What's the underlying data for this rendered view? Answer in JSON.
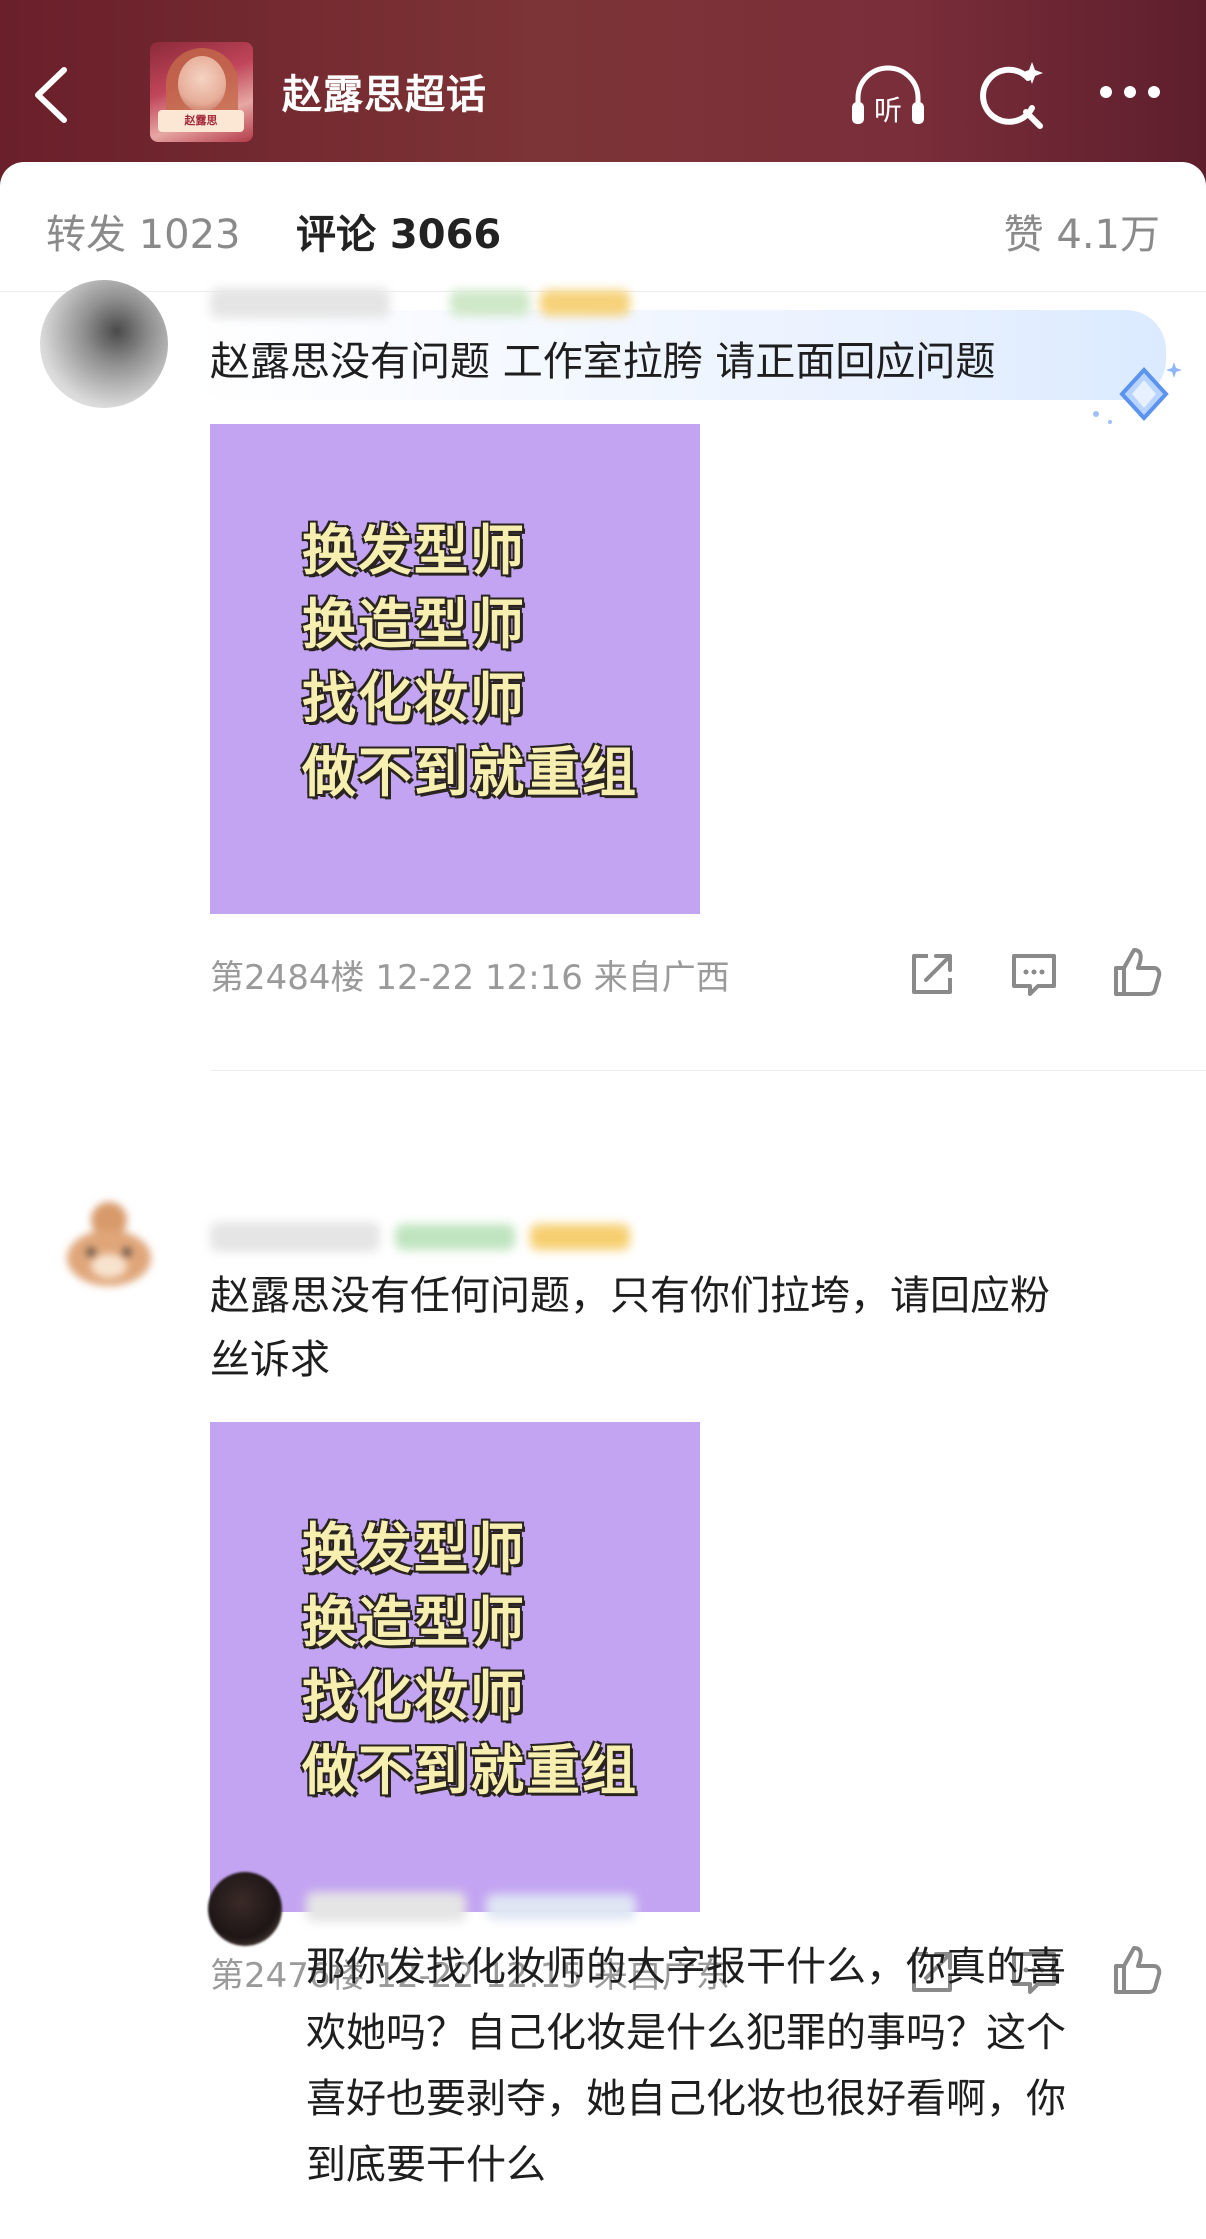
{
  "header": {
    "title": "赵露思超话",
    "avatar_text": "赵露思",
    "icons": [
      "back-arrow-icon",
      "listen-icon",
      "search-icon",
      "more-icon"
    ],
    "listen_label": "听"
  },
  "tabs": {
    "repost": "转发 1023",
    "comments": "评论 3066",
    "likes": "赞 4.1万"
  },
  "comments": [
    {
      "text": "赵露思没有问题 工作室拉胯 请正面回应问题",
      "image_lines": [
        "换发型师",
        "换造型师",
        "找化妆师",
        "做不到就重组"
      ],
      "floor_meta": "第2484楼 12-22 12:16 来自广西"
    },
    {
      "text_line1": "赵露思没有任何问题，只有你们拉垮，请回应粉",
      "text_line2": "丝诉求",
      "image_lines": [
        "换发型师",
        "换造型师",
        "找化妆师",
        "做不到就重组"
      ],
      "floor_meta": "第2476楼 12-22 12:15 来自广东"
    }
  ],
  "reply": {
    "lines": [
      "那你发找化妆师的大字报干什么，你真的喜",
      "欢她吗？自己化妆是什么犯罪的事吗？这个",
      "喜好也要剥夺，她自己化妆也很好看啊，你",
      "到底要干什么"
    ]
  },
  "colors": {
    "header_bg": "#752a32",
    "meme_bg": "#c3a4f2",
    "meme_text": "#f7efb0",
    "meta_text": "#9a9a9a"
  }
}
